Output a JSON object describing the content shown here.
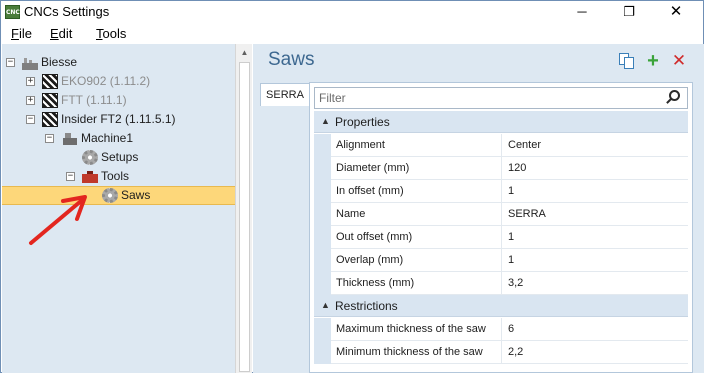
{
  "window": {
    "title": "CNCs Settings",
    "app_icon_text": "CNC",
    "controls": {
      "minimize": "─",
      "maximize": "❐",
      "close": "✕"
    }
  },
  "menu": [
    {
      "label": "File",
      "accel": "F",
      "rest": "ile"
    },
    {
      "label": "Edit",
      "accel": "E",
      "rest": "dit"
    },
    {
      "label": "Tools",
      "accel": "T",
      "rest": "ools"
    }
  ],
  "tree": [
    {
      "label": "Biesse",
      "icon": "factory-icon",
      "expander": "−",
      "dim": false,
      "selected": false
    },
    {
      "label": "EKO902 (1.11.2)",
      "icon": "hatched-machine-icon",
      "expander": "+",
      "dim": true,
      "selected": false
    },
    {
      "label": "FTT (1.11.1)",
      "icon": "hatched-machine-icon",
      "expander": "+",
      "dim": true,
      "selected": false
    },
    {
      "label": "Insider FT2 (1.11.5.1)",
      "icon": "hatched-machine-icon",
      "expander": "−",
      "dim": false,
      "selected": false
    },
    {
      "label": "Machine1",
      "icon": "machine-icon",
      "expander": "−",
      "dim": false,
      "selected": false
    },
    {
      "label": "Setups",
      "icon": "gear-icon",
      "expander": "",
      "dim": false,
      "selected": false
    },
    {
      "label": "Tools",
      "icon": "toolbox-icon",
      "expander": "−",
      "dim": false,
      "selected": false
    },
    {
      "label": "Saws",
      "icon": "gear-icon",
      "expander": "",
      "dim": false,
      "selected": true
    }
  ],
  "content": {
    "title": "Saws",
    "toolbar": {
      "copy_icon": "copy-icon",
      "add_label": "+",
      "delete_label": "✕"
    },
    "tab_label": "SERRA",
    "filter_placeholder": "Filter",
    "properties_header": "Properties",
    "properties": [
      {
        "name": "Alignment",
        "value": "Center"
      },
      {
        "name": "Diameter (mm)",
        "value": "120"
      },
      {
        "name": "In offset (mm)",
        "value": "1"
      },
      {
        "name": "Name",
        "value": "SERRA"
      },
      {
        "name": "Out offset (mm)",
        "value": "1"
      },
      {
        "name": "Overlap (mm)",
        "value": "1"
      },
      {
        "name": "Thickness (mm)",
        "value": "3,2"
      }
    ],
    "restrictions_header": "Restrictions",
    "restrictions": [
      {
        "name": "Maximum thickness of the saw",
        "value": "6"
      },
      {
        "name": "Minimum thickness of the saw",
        "value": "2,2"
      }
    ],
    "collapse_glyph": "▲"
  },
  "colors": {
    "selection": "#fdd77a",
    "panel_bg": "#dde8f2",
    "title_blue": "#3d6890",
    "annotation_arrow": "#e3261f"
  }
}
